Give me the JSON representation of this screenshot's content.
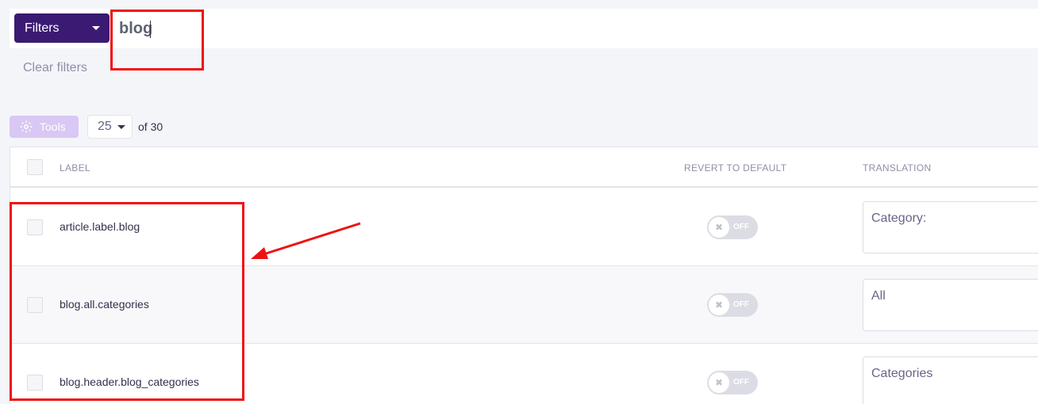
{
  "filters": {
    "button_label": "Filters",
    "search_value": "blog",
    "clear_label": "Clear filters"
  },
  "toolbar": {
    "tools_label": "Tools",
    "page_size": "25",
    "total_label": "of 30"
  },
  "table": {
    "headers": {
      "label": "LABEL",
      "revert": "REVERT TO DEFAULT",
      "translation": "TRANSLATION"
    },
    "rows": [
      {
        "label": "article.label.blog",
        "toggle": "OFF",
        "translation": "Category:"
      },
      {
        "label": "blog.all.categories",
        "toggle": "OFF",
        "translation": "All"
      },
      {
        "label": "blog.header.blog_categories",
        "toggle": "OFF",
        "translation": "Categories"
      }
    ]
  },
  "colors": {
    "primary": "#3b1a73",
    "tools_bg": "#d8c8f3",
    "annotation": "#ee1111"
  },
  "icons": {
    "filters_caret": "caret-down-icon",
    "tools": "gear-icon",
    "toggle": "x-icon"
  }
}
